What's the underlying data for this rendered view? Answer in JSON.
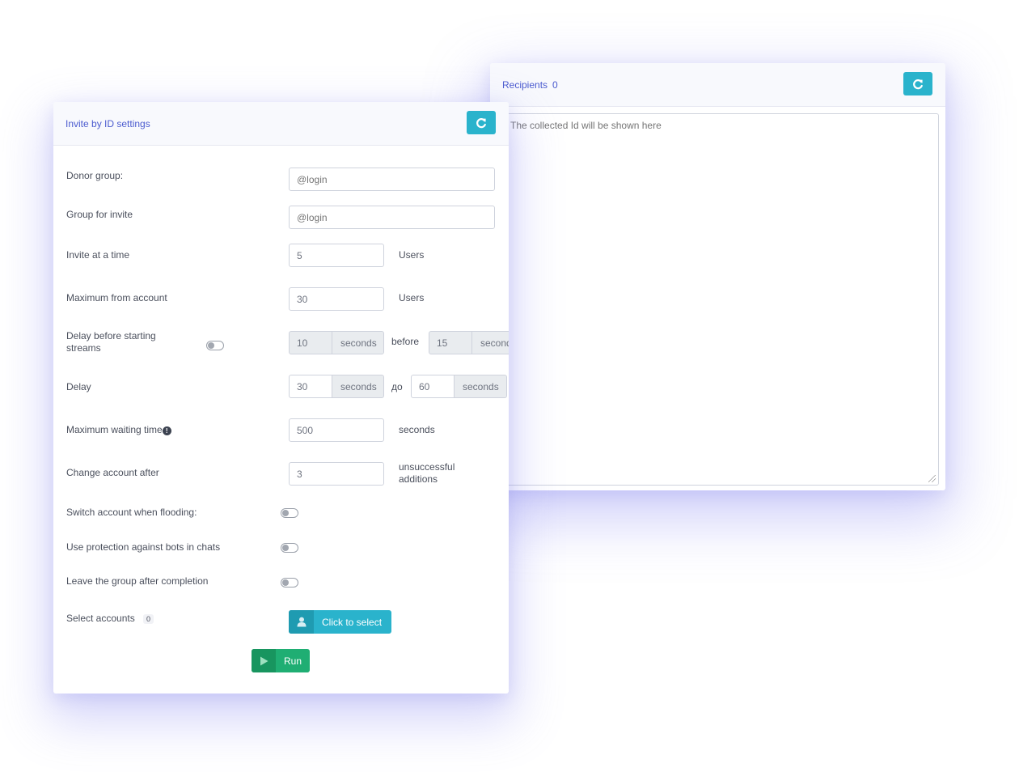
{
  "left_panel": {
    "title": "Invite by ID settings",
    "rows": {
      "donor_group": {
        "label": "Donor group:",
        "placeholder": "@login"
      },
      "group_invite": {
        "label": "Group for invite",
        "placeholder": "@login"
      },
      "invite_at_time": {
        "label": "Invite at a time",
        "value": "5",
        "unit": "Users"
      },
      "max_from_account": {
        "label": "Maximum from account",
        "value": "30",
        "unit": "Users"
      },
      "delay_before": {
        "label_line1": "Delay before starting",
        "label_line2": "streams",
        "from": "10",
        "from_unit": "seconds",
        "between": "before",
        "to": "15",
        "to_unit": "seconds"
      },
      "delay": {
        "label": "Delay",
        "from": "30",
        "from_unit": "seconds",
        "between": "до",
        "to": "60",
        "to_unit": "seconds"
      },
      "max_wait": {
        "label": "Maximum waiting time",
        "value": "500",
        "unit": "seconds"
      },
      "change_account": {
        "label": "Change account after",
        "value": "3",
        "unit_line1": "unsuccessful",
        "unit_line2": "additions"
      },
      "switch_flood": {
        "label": "Switch account when flooding:"
      },
      "bot_protection": {
        "label": "Use protection against bots in chats"
      },
      "leave_group": {
        "label": "Leave the group after completion"
      },
      "select_accounts": {
        "label": "Select accounts",
        "count": "0",
        "button": "Click to select"
      }
    },
    "run_label": "Run"
  },
  "right_panel": {
    "title": "Recipients",
    "count": "0",
    "placeholder": "The collected Id will be shown here"
  },
  "colors": {
    "accent": "#2ab3cc",
    "run": "#1fae73",
    "title": "#4b5bcf"
  }
}
